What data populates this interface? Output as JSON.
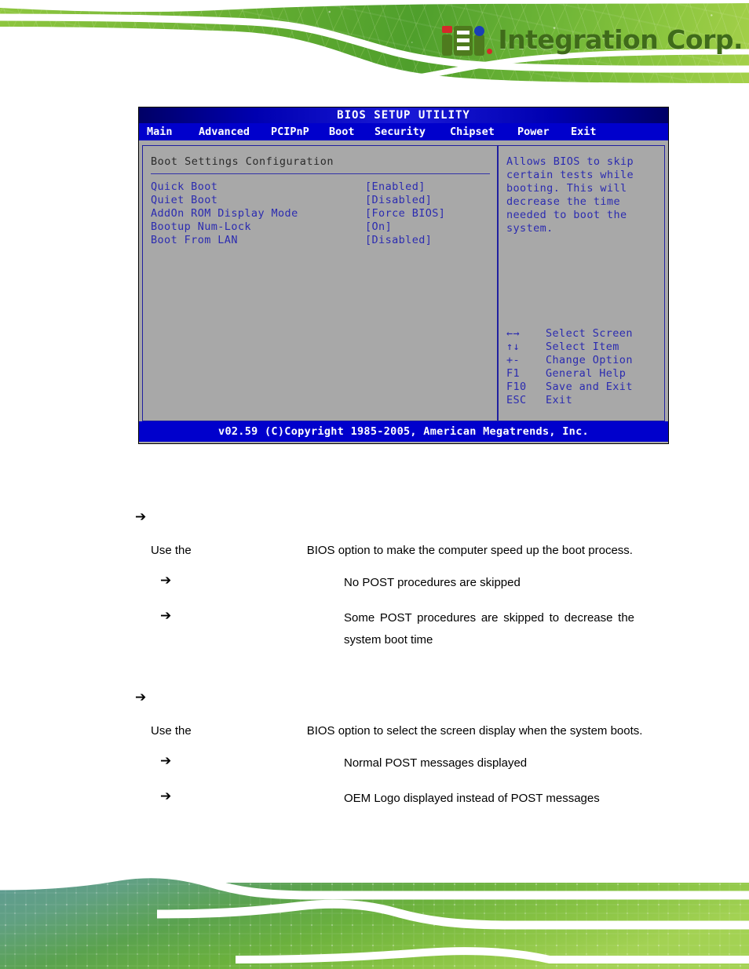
{
  "brand": {
    "logo_initials": "iEi",
    "logo_name": "Integration Corp."
  },
  "bios": {
    "title": "BIOS SETUP UTILITY",
    "menu_tabs": [
      "Main",
      "Advanced",
      "PCIPnP",
      "Boot",
      "Security",
      "Chipset",
      "Power",
      "Exit"
    ],
    "section_heading": "Boot Settings Configuration",
    "options": [
      {
        "label": "Quick Boot",
        "value": "[Enabled]"
      },
      {
        "label": "Quiet Boot",
        "value": "[Disabled]"
      },
      {
        "label": "AddOn ROM Display Mode",
        "value": "[Force BIOS]"
      },
      {
        "label": "Bootup Num-Lock",
        "value": "[On]"
      },
      {
        "label": "Boot From LAN",
        "value": "[Disabled]"
      }
    ],
    "help_text": "Allows BIOS to skip\ncertain tests while\nbooting. This will\ndecrease the time\nneeded to boot the\nsystem.",
    "keys": [
      {
        "key": "←→",
        "desc": "Select Screen"
      },
      {
        "key": "↑↓",
        "desc": "Select Item"
      },
      {
        "key": "+-",
        "desc": "Change Option"
      },
      {
        "key": "F1",
        "desc": "General Help"
      },
      {
        "key": "F10",
        "desc": "Save and Exit"
      },
      {
        "key": "ESC",
        "desc": "Exit"
      }
    ],
    "footer": "v02.59 (C)Copyright 1985-2005, American Megatrends, Inc."
  },
  "doc": {
    "sections": [
      {
        "bullet_icon": "arrow-bullet-icon",
        "heading": "",
        "para_prefix": "Use the",
        "para_option_name": "",
        "para_suffix": "BIOS option to make the computer speed up the boot process.",
        "choices": [
          {
            "name": "",
            "desc": "No POST procedures are skipped",
            "justify": false
          },
          {
            "name": "",
            "desc": "Some POST procedures are skipped to decrease the system boot time",
            "justify": true
          }
        ]
      },
      {
        "bullet_icon": "arrow-bullet-icon",
        "heading": "",
        "para_prefix": "Use the",
        "para_option_name": "",
        "para_suffix": "BIOS option to select the screen display when the system boots.",
        "choices": [
          {
            "name": "",
            "desc": "Normal POST messages displayed",
            "justify": false
          },
          {
            "name": "",
            "desc": "OEM Logo displayed instead of POST messages",
            "justify": false
          }
        ]
      }
    ]
  },
  "colors": {
    "bios_blue": "#0000cc",
    "bios_gray": "#a8a8a8",
    "bios_text_blue": "#2b2bb0",
    "brand_green": "#4e7b1e",
    "brand_red": "#d42a2a",
    "brand_blue": "#1a3fb5"
  }
}
